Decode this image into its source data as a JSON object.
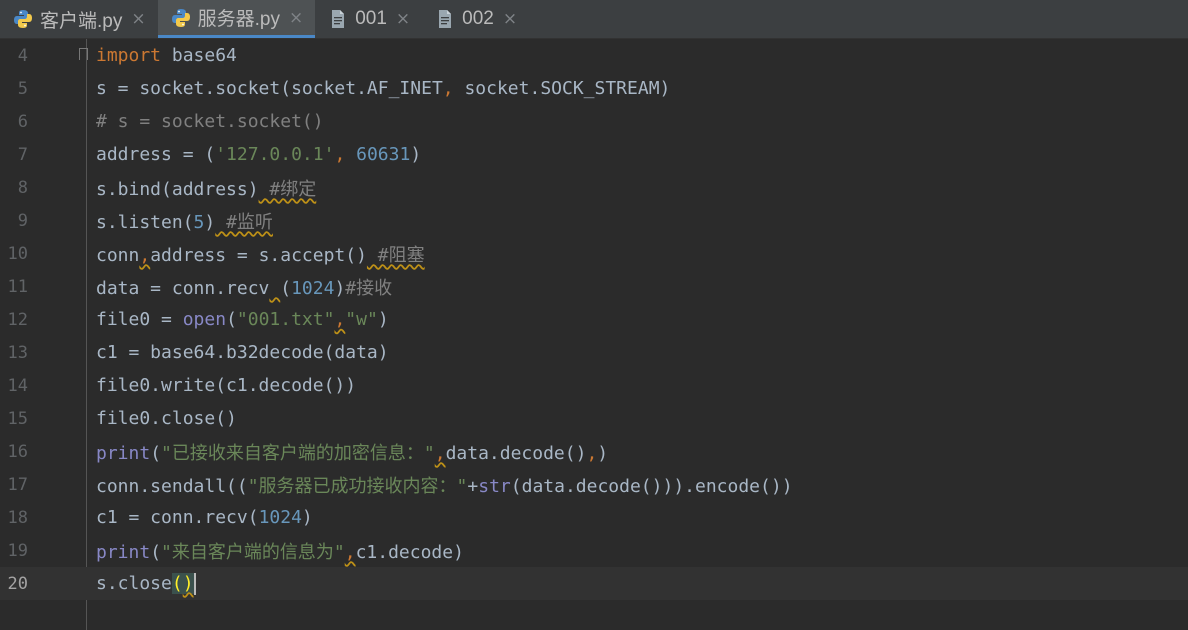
{
  "tabs": [
    {
      "label": "客户端.py",
      "icon": "python-file-icon",
      "active": false
    },
    {
      "label": "服务器.py",
      "icon": "python-file-icon",
      "active": true
    },
    {
      "label": "001",
      "icon": "text-file-icon",
      "active": false
    },
    {
      "label": "002",
      "icon": "text-file-icon",
      "active": false
    }
  ],
  "close_glyph": "×",
  "colors": {
    "background": "#2b2b2b",
    "keyword": "#cc7832",
    "string": "#6a8759",
    "number": "#6897bb",
    "comment": "#808080",
    "builtin": "#8888c6",
    "active_tab_underline": "#4a88c7"
  },
  "current_line": 20,
  "lines": [
    {
      "num": "4",
      "t": [
        "import",
        " base64"
      ]
    },
    {
      "num": "5",
      "t": [
        "s = socket.socket(socket.AF_INET",
        ",",
        " socket.SOCK_STREAM)"
      ]
    },
    {
      "num": "6",
      "t": [
        "# s = socket.socket()"
      ]
    },
    {
      "num": "7",
      "t": [
        "address = (",
        "'127.0.0.1'",
        ", ",
        "60631",
        ")"
      ]
    },
    {
      "num": "8",
      "t": [
        "s.bind(address)",
        " #绑定"
      ]
    },
    {
      "num": "9",
      "t": [
        "s.listen(",
        "5",
        ")",
        " #监听"
      ]
    },
    {
      "num": "10",
      "t": [
        "conn",
        ",",
        "address = s.accept()",
        " #阻塞"
      ]
    },
    {
      "num": "11",
      "t": [
        "data = conn.recv",
        " ",
        "(",
        "1024",
        ")",
        "#接收"
      ]
    },
    {
      "num": "12",
      "t": [
        "file0 = ",
        "open",
        "(",
        "\"001.txt\"",
        ",",
        "\"w\"",
        ")"
      ]
    },
    {
      "num": "13",
      "t": [
        "c1 = base64.b32decode(data)"
      ]
    },
    {
      "num": "14",
      "t": [
        "file0.write(c1.decode())"
      ]
    },
    {
      "num": "15",
      "t": [
        "file0.close()"
      ]
    },
    {
      "num": "16",
      "t": [
        "print",
        "(",
        "\"已接收来自客户端的加密信息：\"",
        ",",
        "data.decode()",
        ",",
        ")"
      ]
    },
    {
      "num": "17",
      "t": [
        "conn.sendall((",
        "\"服务器已成功接收内容：\"",
        "+",
        "str",
        "(data.decode())).encode())"
      ]
    },
    {
      "num": "18",
      "t": [
        "c1 = conn.recv(",
        "1024",
        ")"
      ]
    },
    {
      "num": "19",
      "t": [
        "print",
        "(",
        "\"来自客户端的信息为\"",
        ",",
        "c1.decode)"
      ]
    },
    {
      "num": "20",
      "t": [
        "s.close",
        "(",
        ")"
      ]
    }
  ]
}
